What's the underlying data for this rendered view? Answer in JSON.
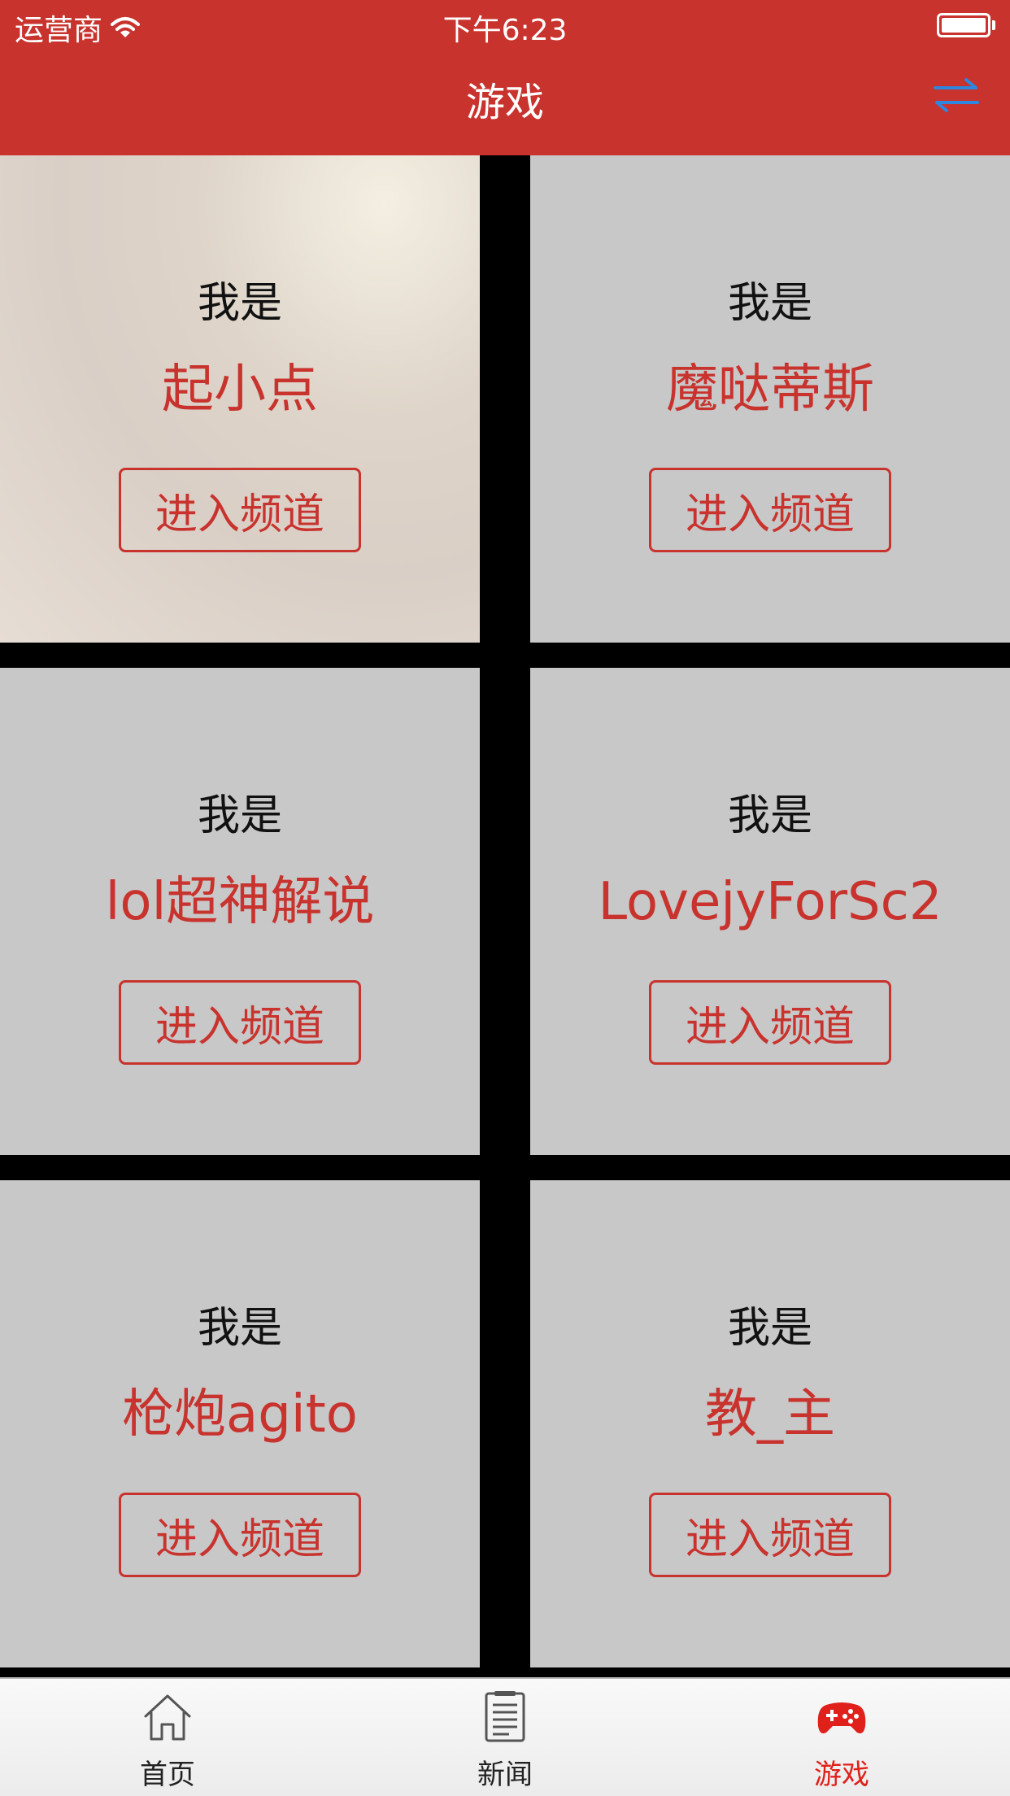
{
  "status_bar": {
    "carrier": "运营商",
    "time": "下午6:23"
  },
  "nav": {
    "title": "游戏",
    "switch_icon": "swap-arrows-icon"
  },
  "channels": [
    {
      "intro": "我是",
      "name": "起小点",
      "button": "进入频道"
    },
    {
      "intro": "我是",
      "name": "魔哒蒂斯",
      "button": "进入频道"
    },
    {
      "intro": "我是",
      "name": "lol超神解说",
      "button": "进入频道"
    },
    {
      "intro": "我是",
      "name": "LovejyForSc2",
      "button": "进入频道"
    },
    {
      "intro": "我是",
      "name": "枪炮agito",
      "button": "进入频道"
    },
    {
      "intro": "我是",
      "name": "教_主",
      "button": "进入频道"
    }
  ],
  "tab_bar": {
    "tabs": [
      {
        "label": "首页",
        "icon": "house-icon"
      },
      {
        "label": "新闻",
        "icon": "news-document-icon"
      },
      {
        "label": "游戏",
        "icon": "gamepad-icon",
        "active": true
      }
    ]
  },
  "colors": {
    "brand": "#c8332e",
    "active_tab": "#e0201a",
    "switch_icon": "#2e86de"
  }
}
